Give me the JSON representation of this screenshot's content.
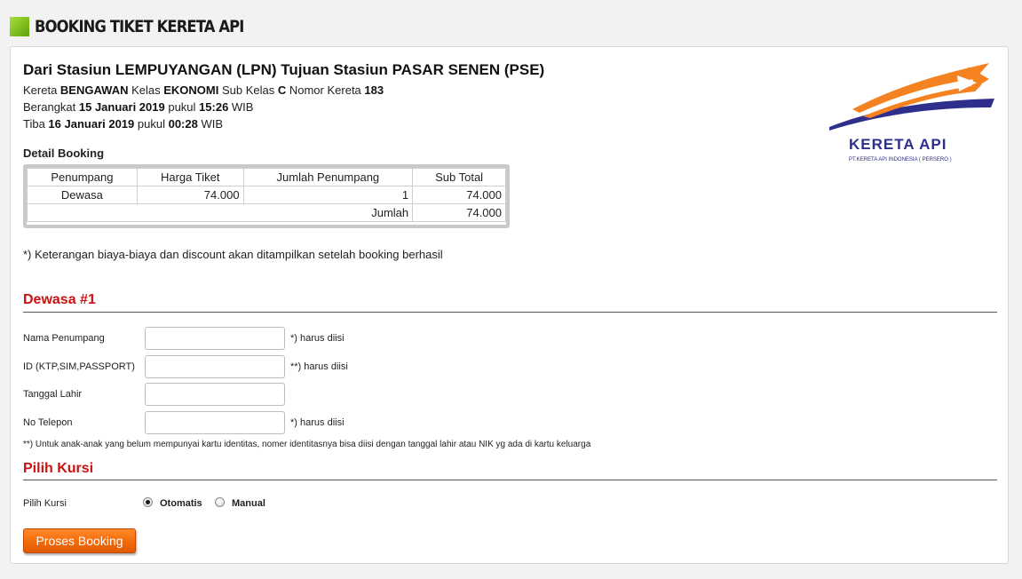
{
  "header": {
    "title": "BOOKING TIKET KERETA API"
  },
  "trip": {
    "route_prefix": "Dari Stasiun ",
    "origin": "LEMPUYANGAN (LPN)",
    "route_mid": " Tujuan Stasiun ",
    "destination": "PASAR SENEN (PSE)",
    "train_prefix": "Kereta ",
    "train_name": "BENGAWAN",
    "class_prefix": " Kelas ",
    "class_name": "EKONOMI",
    "subclass_prefix": " Sub Kelas ",
    "subclass": "C",
    "number_prefix": " Nomor Kereta ",
    "train_number": "183",
    "depart_prefix": "Berangkat ",
    "depart_date": "15 Januari 2019",
    "depart_mid": " pukul ",
    "depart_time": "15:26",
    "depart_suffix": " WIB",
    "arrive_prefix": "Tiba ",
    "arrive_date": "16 Januari 2019",
    "arrive_mid": " pukul ",
    "arrive_time": "00:28",
    "arrive_suffix": " WIB"
  },
  "logo": {
    "text": "KERETA API",
    "subtext": "PT.KERETA API INDONESIA ( PERSERO )",
    "colors": {
      "orange": "#f58220",
      "blue": "#2e2f8c"
    }
  },
  "detail": {
    "label": "Detail Booking",
    "columns": [
      "Penumpang",
      "Harga Tiket",
      "Jumlah Penumpang",
      "Sub Total"
    ],
    "rows": [
      {
        "passenger": "Dewasa",
        "price": "74.000",
        "count": "1",
        "subtotal": "74.000"
      }
    ],
    "total_label": "Jumlah",
    "total_value": "74.000"
  },
  "note": "*) Keterangan biaya-biaya dan discount akan ditampilkan setelah booking berhasil",
  "passenger_section": {
    "title": "Dewasa #1",
    "fields": [
      {
        "label": "Nama Penumpang",
        "value": "",
        "hint": "*) harus diisi"
      },
      {
        "label": "ID (KTP,SIM,PASSPORT)",
        "value": "",
        "hint": "**) harus diisi"
      },
      {
        "label": "Tanggal Lahir",
        "value": "",
        "hint": ""
      },
      {
        "label": "No Telepon",
        "value": "",
        "hint": "*) harus diisi"
      }
    ],
    "footnote": "**) Untuk anak-anak yang belum mempunyai kartu identitas, nomer identitasnya bisa diisi dengan tanggal lahir atau NIK yg ada di kartu keluarga"
  },
  "seat_section": {
    "title": "Pilih Kursi",
    "label": "Pilih Kursi",
    "options": [
      {
        "label": "Otomatis",
        "selected": true
      },
      {
        "label": "Manual",
        "selected": false
      }
    ]
  },
  "submit": {
    "label": "Proses Booking",
    "color": "#f26a0a"
  },
  "colors": {
    "section_title": "#cc1111",
    "header_icon": "#7fbf1f"
  }
}
